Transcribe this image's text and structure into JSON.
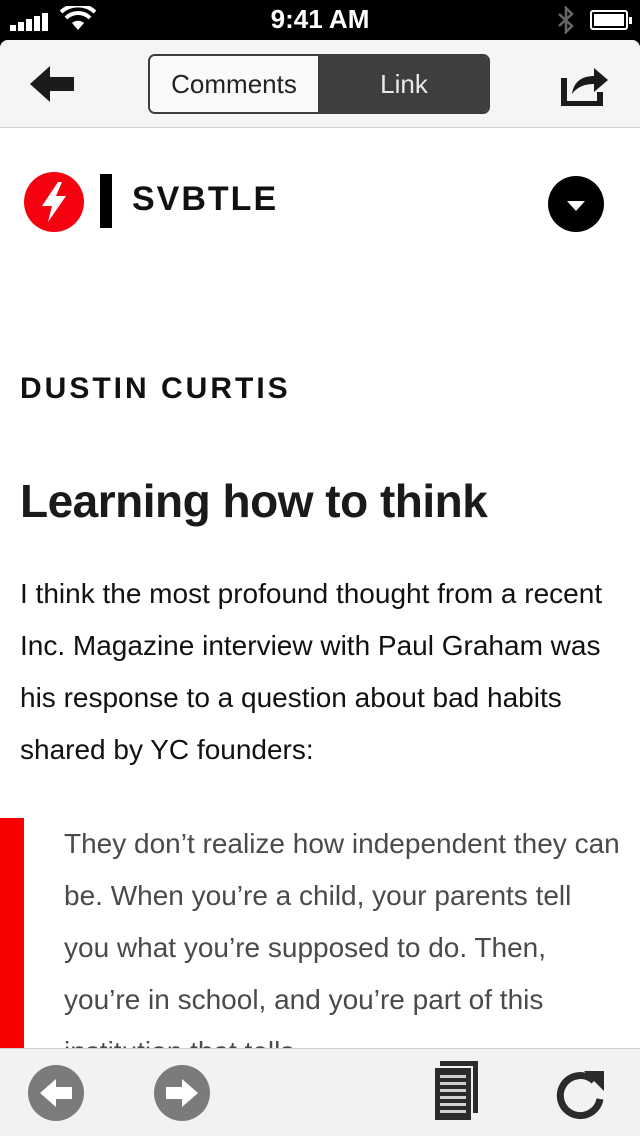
{
  "status_bar": {
    "time": "9:41 AM"
  },
  "nav": {
    "segments": [
      "Comments",
      "Link"
    ],
    "selected_segment": "Link"
  },
  "article": {
    "brand": "SVBTLE",
    "author": "DUSTIN CURTIS",
    "title": "Learning how to think",
    "paragraph": "I think the most profound thought from a recent Inc. Magazine interview with Paul Graham was his response to a question about bad habits shared by YC founders:",
    "quote": "They don’t realize how independent they can be. When you’re a child, your parents tell you what you’re supposed to do. Then, you’re in school, and you’re part of this institution that tells"
  },
  "colors": {
    "accent_red": "#f5010f",
    "quote_bar": "#f70000",
    "segment_active": "#3e3e3e"
  },
  "icons": {
    "back": "arrow-left-icon",
    "share": "share-icon",
    "logo": "lightning-bolt-icon",
    "menu": "chevron-down-icon",
    "browser_back": "circle-arrow-left-icon",
    "browser_forward": "circle-arrow-right-icon",
    "reader": "document-icon",
    "reload": "reload-icon"
  }
}
